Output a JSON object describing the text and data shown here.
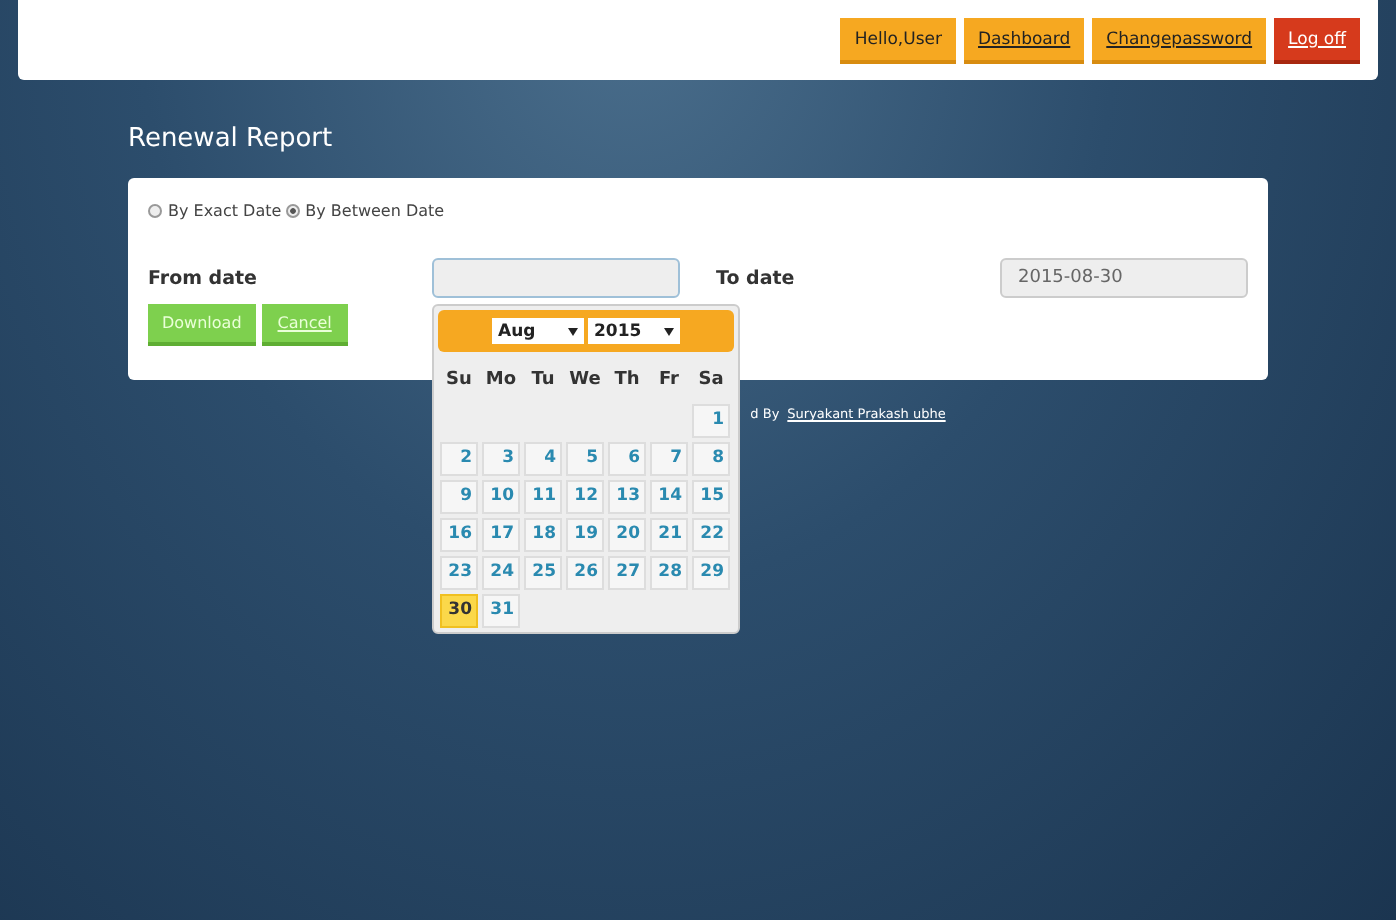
{
  "nav": [
    {
      "label": "Hello,User",
      "kind": "greeting"
    },
    {
      "label": "Dashboard",
      "kind": "link"
    },
    {
      "label": "Changepassword",
      "kind": "link"
    },
    {
      "label": "Log off",
      "kind": "danger"
    }
  ],
  "page_title": "Renewal Report",
  "filter": [
    {
      "label": "By Exact Date",
      "selected": false
    },
    {
      "label": "By Between Date",
      "selected": true
    }
  ],
  "from_date": {
    "label": "From date"
  },
  "to_date": {
    "label": "To date",
    "value": "2015-08-30"
  },
  "buttons": [
    {
      "label": "Download",
      "kind": "primary"
    },
    {
      "label": "Cancel",
      "kind": "link"
    }
  ],
  "calendar": {
    "month": "Aug",
    "year": "2015",
    "weekdays": [
      "Su",
      "Mo",
      "Tu",
      "We",
      "Th",
      "Fr",
      "Sa"
    ],
    "weeks": [
      [
        {
          "label": "1",
          "selected": false
        }
      ],
      [
        {
          "label": "2",
          "selected": false
        },
        {
          "label": "3",
          "selected": false
        },
        {
          "label": "4",
          "selected": false
        },
        {
          "label": "5",
          "selected": false
        },
        {
          "label": "6",
          "selected": false
        },
        {
          "label": "7",
          "selected": false
        },
        {
          "label": "8",
          "selected": false
        }
      ],
      [
        {
          "label": "9",
          "selected": false
        },
        {
          "label": "10",
          "selected": false
        },
        {
          "label": "11",
          "selected": false
        },
        {
          "label": "12",
          "selected": false
        },
        {
          "label": "13",
          "selected": false
        },
        {
          "label": "14",
          "selected": false
        },
        {
          "label": "15",
          "selected": false
        }
      ],
      [
        {
          "label": "16",
          "selected": false
        },
        {
          "label": "17",
          "selected": false
        },
        {
          "label": "18",
          "selected": false
        },
        {
          "label": "19",
          "selected": false
        },
        {
          "label": "20",
          "selected": false
        },
        {
          "label": "21",
          "selected": false
        },
        {
          "label": "22",
          "selected": false
        }
      ],
      [
        {
          "label": "23",
          "selected": false
        },
        {
          "label": "24",
          "selected": false
        },
        {
          "label": "25",
          "selected": false
        },
        {
          "label": "26",
          "selected": false
        },
        {
          "label": "27",
          "selected": false
        },
        {
          "label": "28",
          "selected": false
        },
        {
          "label": "29",
          "selected": false
        }
      ],
      [
        {
          "label": "30",
          "selected": true
        },
        {
          "label": "31",
          "selected": false
        }
      ]
    ]
  },
  "footer": {
    "text": "d By",
    "author": "Suryakant Prakash ubhe"
  }
}
